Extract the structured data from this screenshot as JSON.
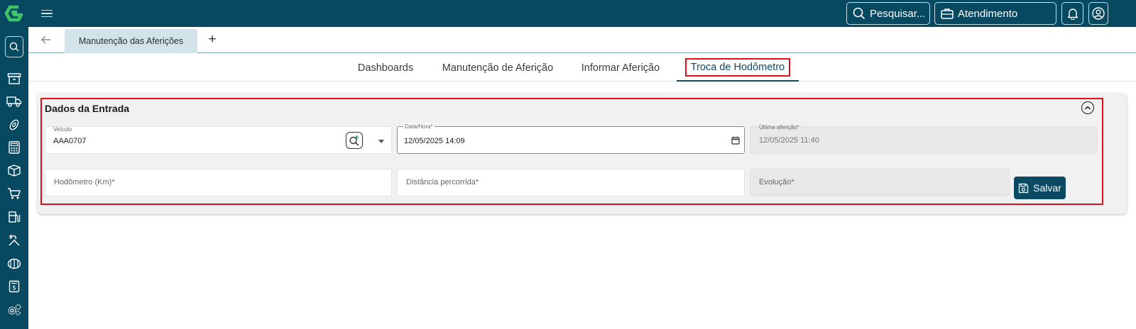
{
  "topbar": {
    "search_label": "Pesquisar...",
    "service_label": "Atendimento"
  },
  "tabs": {
    "open_tab_label": "Manutenção das Aferições",
    "add_tab_label": "+"
  },
  "subtabs": [
    {
      "label": "Dashboards"
    },
    {
      "label": "Manutenção de Aferição"
    },
    {
      "label": "Informar Aferição"
    },
    {
      "label": "Troca de Hodômetro"
    }
  ],
  "form": {
    "section_title": "Dados da Entrada",
    "vehicle": {
      "label": "Veículo",
      "value": "AAA0707"
    },
    "datetime": {
      "label": "Data/Hora*",
      "value": "12/05/2025 14:09"
    },
    "last_measurement": {
      "label": "Última aferição*",
      "value": "12/05/2025 11:40"
    },
    "odometer": {
      "placeholder": "Hodômetro (Km)*"
    },
    "distance": {
      "placeholder": "Distância percorrida*"
    },
    "evolution": {
      "placeholder": "Evolução*"
    },
    "save_label": "Salvar"
  },
  "colors": {
    "brand": "#064960",
    "accent": "#0b4a62",
    "highlight": "#e0101c",
    "logo": "#3fc46a"
  }
}
